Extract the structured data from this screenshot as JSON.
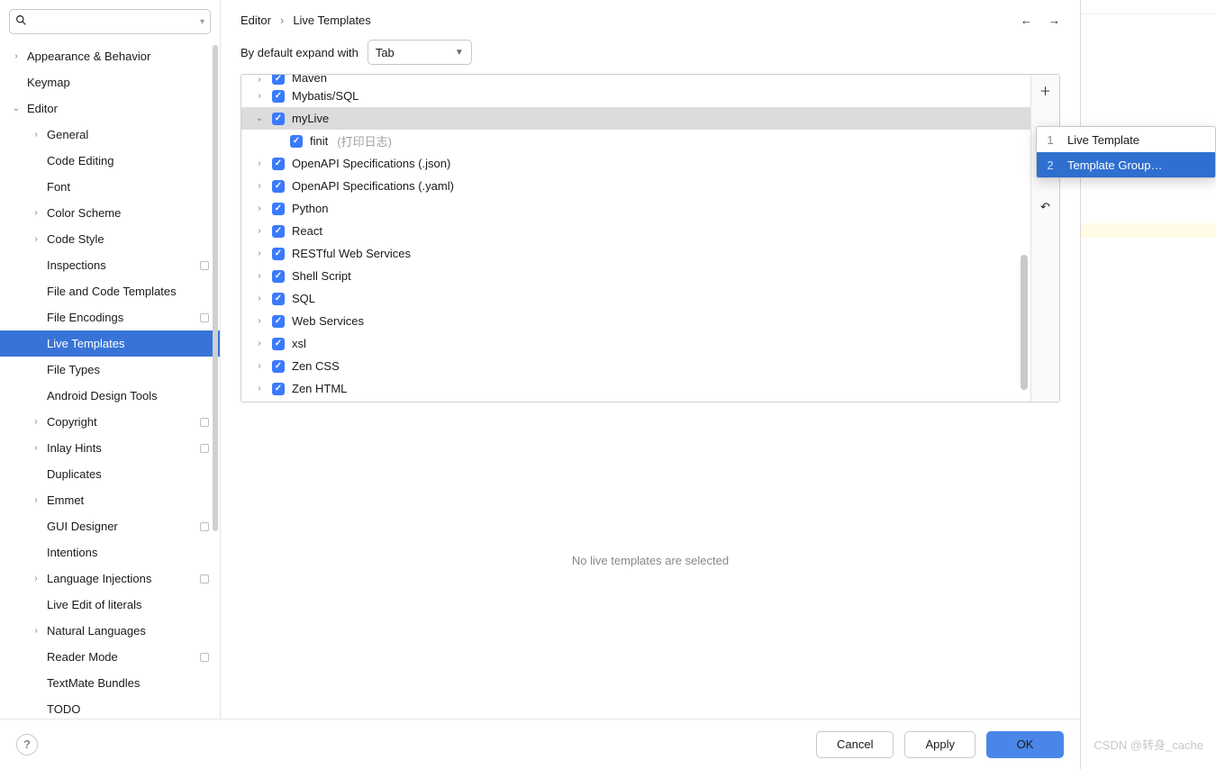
{
  "search": {
    "placeholder": ""
  },
  "sidebar": {
    "items": [
      {
        "label": "Appearance & Behavior",
        "level": 0,
        "arrow": "right"
      },
      {
        "label": "Keymap",
        "level": 0
      },
      {
        "label": "Editor",
        "level": 0,
        "arrow": "down"
      },
      {
        "label": "General",
        "level": 1,
        "arrow": "right"
      },
      {
        "label": "Code Editing",
        "level": 1
      },
      {
        "label": "Font",
        "level": 1
      },
      {
        "label": "Color Scheme",
        "level": 1,
        "arrow": "right"
      },
      {
        "label": "Code Style",
        "level": 1,
        "arrow": "right"
      },
      {
        "label": "Inspections",
        "level": 1,
        "badge": true
      },
      {
        "label": "File and Code Templates",
        "level": 1
      },
      {
        "label": "File Encodings",
        "level": 1,
        "badge": true
      },
      {
        "label": "Live Templates",
        "level": 1,
        "selected": true
      },
      {
        "label": "File Types",
        "level": 1
      },
      {
        "label": "Android Design Tools",
        "level": 1
      },
      {
        "label": "Copyright",
        "level": 1,
        "arrow": "right",
        "badge": true
      },
      {
        "label": "Inlay Hints",
        "level": 1,
        "arrow": "right",
        "badge": true
      },
      {
        "label": "Duplicates",
        "level": 1
      },
      {
        "label": "Emmet",
        "level": 1,
        "arrow": "right"
      },
      {
        "label": "GUI Designer",
        "level": 1,
        "badge": true
      },
      {
        "label": "Intentions",
        "level": 1
      },
      {
        "label": "Language Injections",
        "level": 1,
        "arrow": "right",
        "badge": true
      },
      {
        "label": "Live Edit of literals",
        "level": 1
      },
      {
        "label": "Natural Languages",
        "level": 1,
        "arrow": "right"
      },
      {
        "label": "Reader Mode",
        "level": 1,
        "badge": true
      },
      {
        "label": "TextMate Bundles",
        "level": 1
      },
      {
        "label": "TODO",
        "level": 1
      }
    ]
  },
  "breadcrumb": {
    "parts": [
      "Editor",
      "Live Templates"
    ],
    "sep": "›"
  },
  "expand": {
    "label": "By default expand with",
    "value": "Tab"
  },
  "templates": [
    {
      "label": "Maven",
      "arrow": "right",
      "cut": true
    },
    {
      "label": "Mybatis/SQL",
      "arrow": "right"
    },
    {
      "label": "myLive",
      "arrow": "down",
      "selected": true
    },
    {
      "label": "finit",
      "hint": "(打印日志)",
      "child": true
    },
    {
      "label": "OpenAPI Specifications (.json)",
      "arrow": "right"
    },
    {
      "label": "OpenAPI Specifications (.yaml)",
      "arrow": "right"
    },
    {
      "label": "Python",
      "arrow": "right"
    },
    {
      "label": "React",
      "arrow": "right"
    },
    {
      "label": "RESTful Web Services",
      "arrow": "right"
    },
    {
      "label": "Shell Script",
      "arrow": "right"
    },
    {
      "label": "SQL",
      "arrow": "right"
    },
    {
      "label": "Web Services",
      "arrow": "right"
    },
    {
      "label": "xsl",
      "arrow": "right"
    },
    {
      "label": "Zen CSS",
      "arrow": "right"
    },
    {
      "label": "Zen HTML",
      "arrow": "right"
    }
  ],
  "empty": "No live templates are selected",
  "buttons": {
    "cancel": "Cancel",
    "apply": "Apply",
    "ok": "OK"
  },
  "popup": {
    "items": [
      {
        "num": "1",
        "label": "Live Template"
      },
      {
        "num": "2",
        "label": "Template Group…",
        "selected": true
      }
    ]
  },
  "watermark": "CSDN @转身_cache"
}
